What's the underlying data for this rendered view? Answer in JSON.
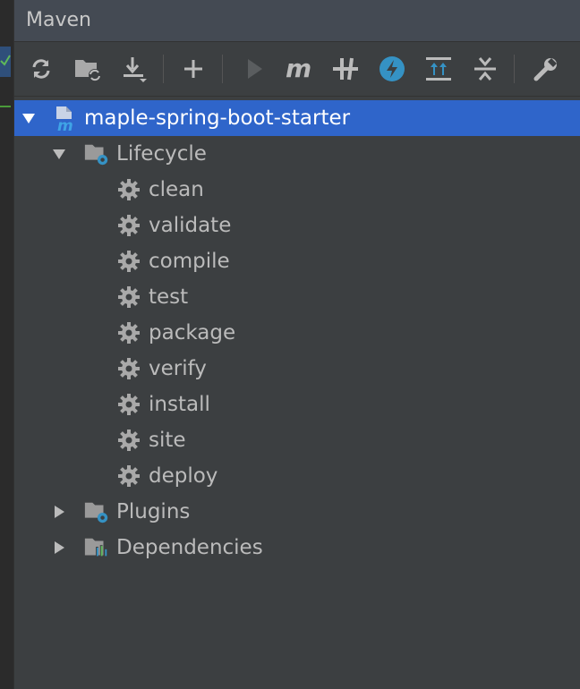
{
  "panel": {
    "title": "Maven"
  },
  "toolbar": {
    "buttons": [
      {
        "name": "reload-all-projects-button",
        "icon": "refresh-icon"
      },
      {
        "name": "generate-sources-button",
        "icon": "folder-refresh-icon"
      },
      {
        "name": "download-sources-button",
        "icon": "download-icon"
      },
      {
        "name": "add-project-button",
        "icon": "plus-icon"
      },
      {
        "name": "run-button",
        "icon": "play-icon"
      },
      {
        "name": "execute-goal-button",
        "icon": "maven-m-icon"
      },
      {
        "name": "toggle-offline-button",
        "icon": "offline-icon"
      },
      {
        "name": "skip-tests-button",
        "icon": "lightning-icon"
      },
      {
        "name": "show-dependencies-button",
        "icon": "expand-icon"
      },
      {
        "name": "collapse-all-button",
        "icon": "collapse-icon"
      },
      {
        "name": "settings-button",
        "icon": "wrench-icon"
      }
    ]
  },
  "tree": {
    "project": "maple-spring-boot-starter",
    "lifecycle": {
      "label": "Lifecycle",
      "items": [
        "clean",
        "validate",
        "compile",
        "test",
        "package",
        "verify",
        "install",
        "site",
        "deploy"
      ]
    },
    "plugins": {
      "label": "Plugins"
    },
    "dependencies": {
      "label": "Dependencies"
    }
  },
  "colors": {
    "selection": "#2f65ca",
    "accent_blue": "#3592c4",
    "background": "#3c3f41",
    "header": "#444a53"
  }
}
